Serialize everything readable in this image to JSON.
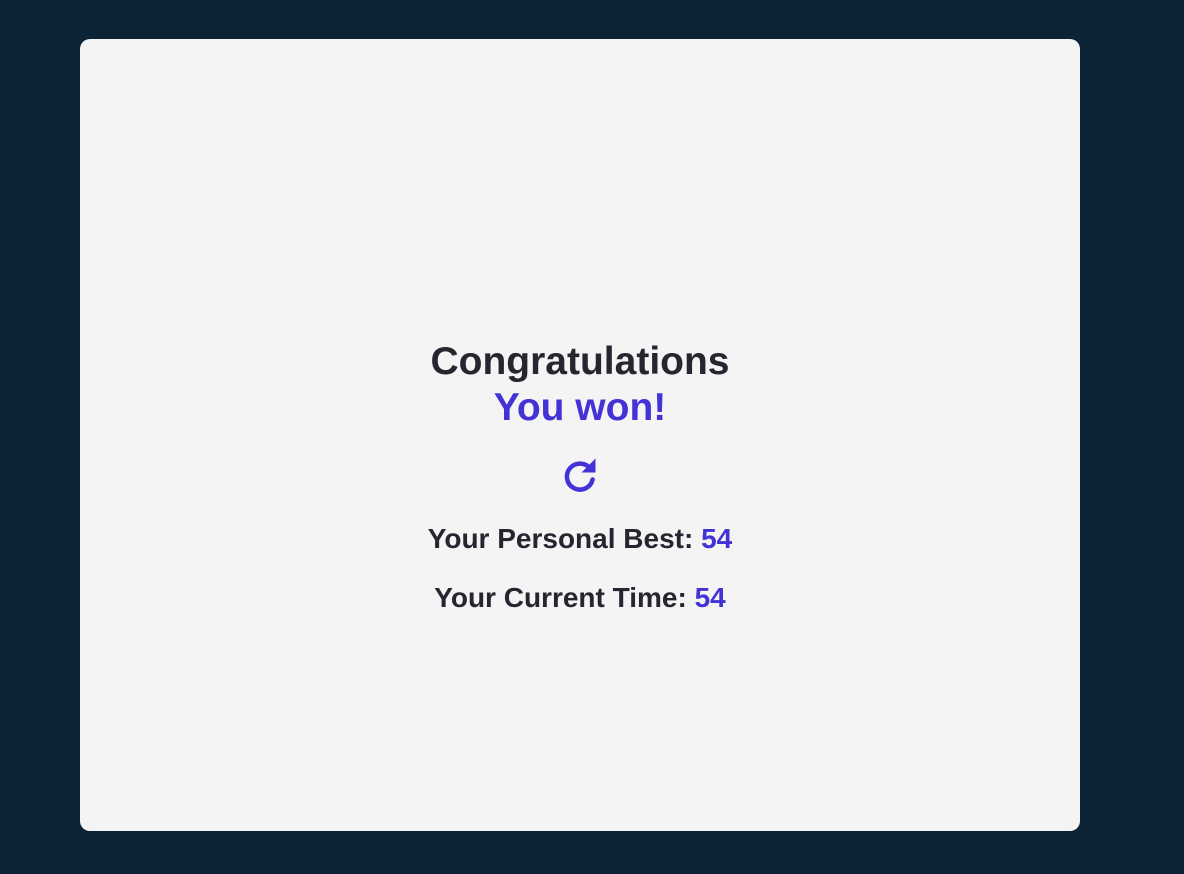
{
  "result": {
    "heading": "Congratulations",
    "subheading": "You won!"
  },
  "restart": {
    "icon": "rotate-right-icon"
  },
  "stats": {
    "personal_best_label": "Your Personal Best: ",
    "personal_best_value": "54",
    "current_time_label": "Your Current Time: ",
    "current_time_value": "54"
  },
  "colors": {
    "background": "#0c2335",
    "card": "#f4f4f4",
    "text": "#27252f",
    "accent": "#4332d6"
  }
}
